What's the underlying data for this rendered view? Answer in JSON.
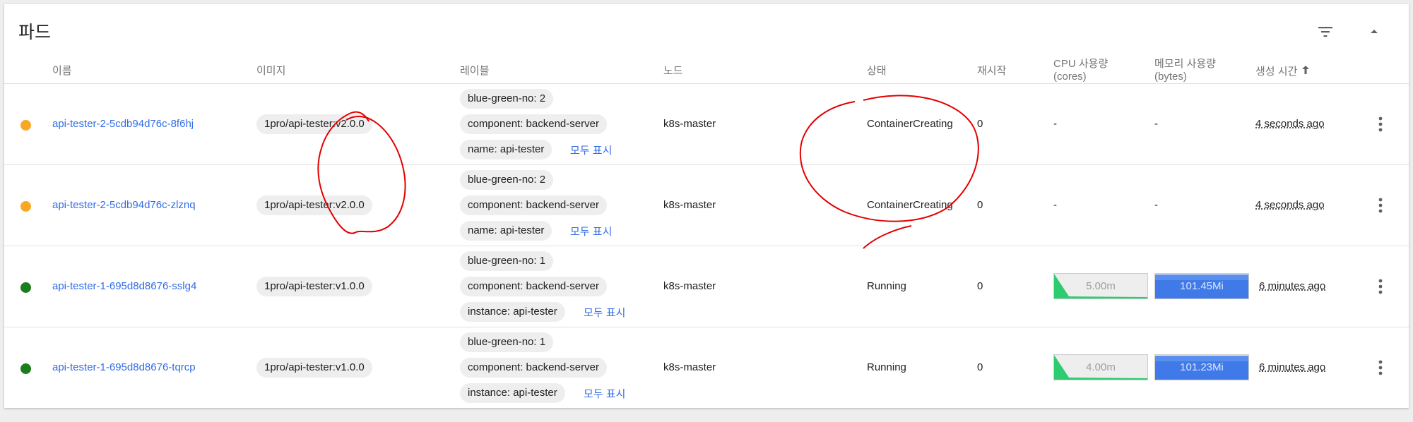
{
  "card": {
    "title": "파드",
    "filter_icon": "filter-list-icon",
    "collapse_icon": "expand-less-icon"
  },
  "columns": {
    "name": "이름",
    "image": "이미지",
    "labels": "레이블",
    "node": "노드",
    "status": "상태",
    "restarts": "재시작",
    "cpu_line1": "CPU 사용량",
    "cpu_line2": "(cores)",
    "mem_line1": "메모리 사용량",
    "mem_line2": "(bytes)",
    "created": "생성 시간",
    "sort_icon": "arrow-upward-icon"
  },
  "pods": [
    {
      "status_color": "#f9a825",
      "name": "api-tester-2-5cdb94d76c-8f6hj",
      "image": "1pro/api-tester:v2.0.0",
      "labels": [
        "blue-green-no: 2",
        "component: backend-server",
        "name: api-tester"
      ],
      "show_all": "모두 표시",
      "node": "k8s-master",
      "status": "ContainerCreating",
      "restarts": "0",
      "cpu": "-",
      "memory": "-",
      "age": "4 seconds ago"
    },
    {
      "status_color": "#f9a825",
      "name": "api-tester-2-5cdb94d76c-zlznq",
      "image": "1pro/api-tester:v2.0.0",
      "labels": [
        "blue-green-no: 2",
        "component: backend-server",
        "name: api-tester"
      ],
      "show_all": "모두 표시",
      "node": "k8s-master",
      "status": "ContainerCreating",
      "restarts": "0",
      "cpu": "-",
      "memory": "-",
      "age": "4 seconds ago"
    },
    {
      "status_color": "#1b7d1b",
      "name": "api-tester-1-695d8d8676-sslg4",
      "image": "1pro/api-tester:v1.0.0",
      "labels": [
        "blue-green-no: 1",
        "component: backend-server",
        "instance: api-tester"
      ],
      "show_all": "모두 표시",
      "node": "k8s-master",
      "status": "Running",
      "restarts": "0",
      "cpu": "5.00m",
      "memory": "101.45Mi",
      "age": "6 minutes ago"
    },
    {
      "status_color": "#1b7d1b",
      "name": "api-tester-1-695d8d8676-tqrcp",
      "image": "1pro/api-tester:v1.0.0",
      "labels": [
        "blue-green-no: 1",
        "component: backend-server",
        "instance: api-tester"
      ],
      "show_all": "모두 표시",
      "node": "k8s-master",
      "status": "Running",
      "restarts": "0",
      "cpu": "4.00m",
      "memory": "101.23Mi",
      "age": "6 minutes ago"
    }
  ],
  "row_menu_icon": "more-vert-icon",
  "colors": {
    "link": "#326de6",
    "cpu_spark": "#2ecc71",
    "mem_spark": "#326de6",
    "annotation": "#e30000"
  }
}
